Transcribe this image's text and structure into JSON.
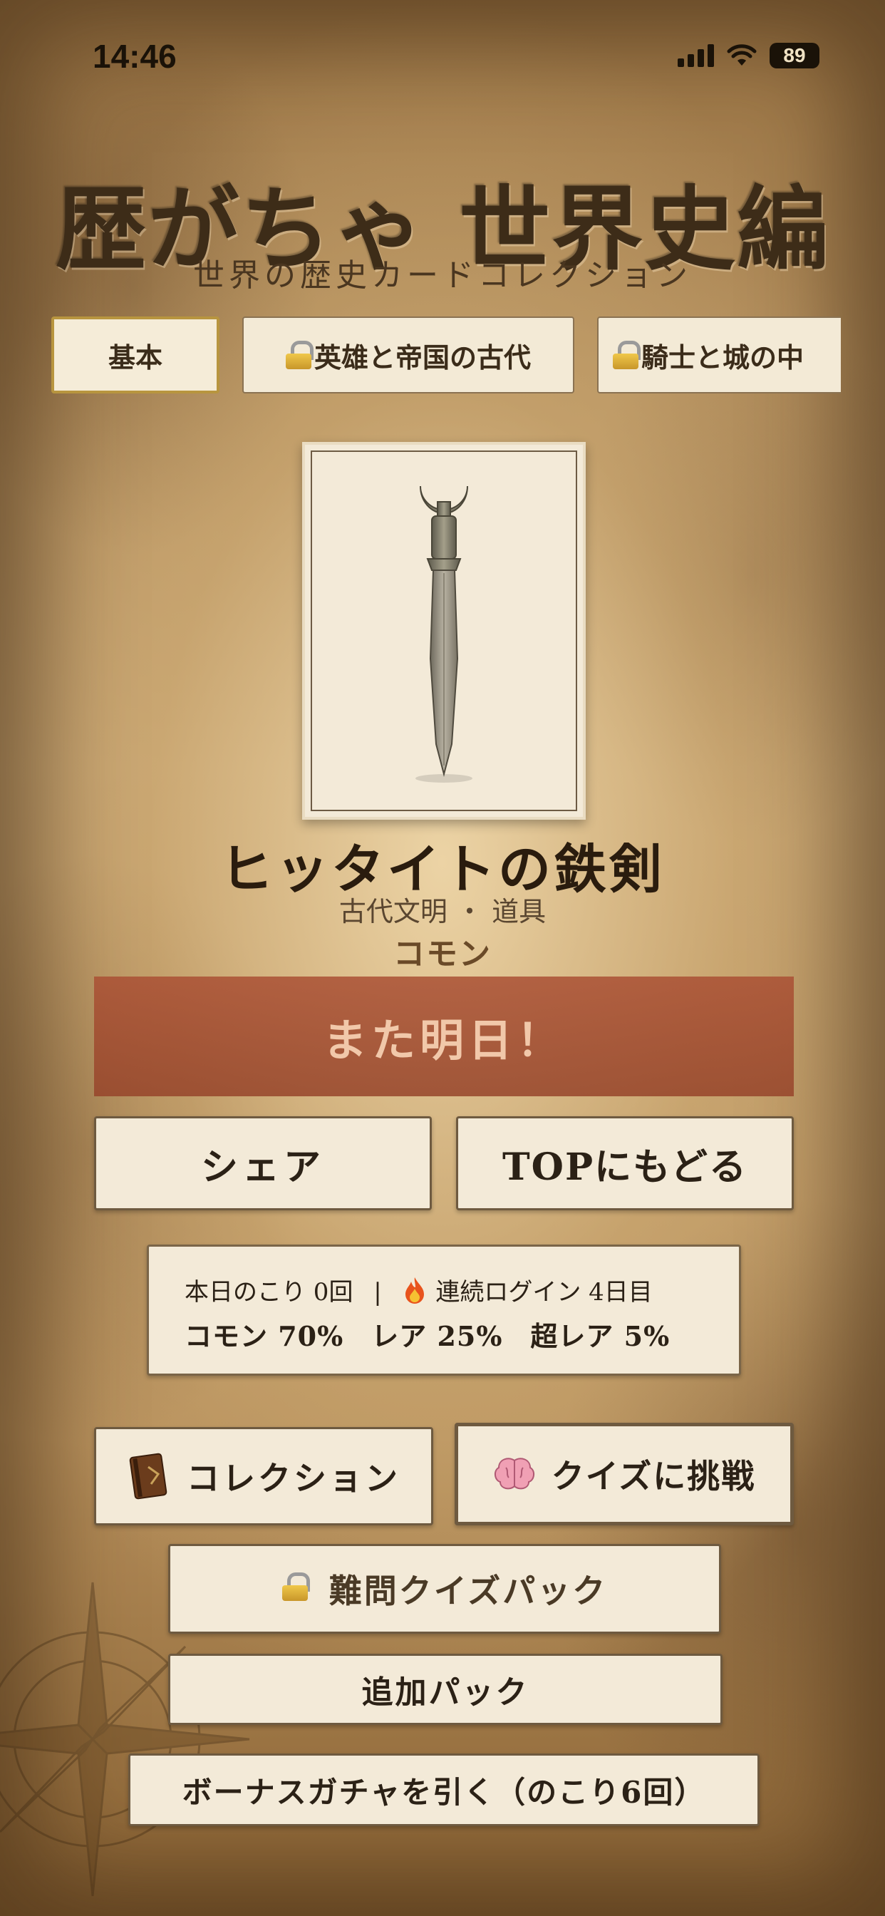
{
  "status_bar": {
    "time": "14:46",
    "battery": "89"
  },
  "header": {
    "title": "歴がちゃ 世界史編",
    "subtitle": "世界の歴史カードコレクション"
  },
  "tabs": [
    {
      "label": "基本",
      "locked": false,
      "active": true
    },
    {
      "label": "英雄と帝国の古代",
      "locked": true,
      "active": false
    },
    {
      "label": "騎士と城の中",
      "locked": true,
      "active": false
    }
  ],
  "card": {
    "name": "ヒッタイトの鉄剣",
    "meta": "古代文明 ・ 道具",
    "rarity": "コモン",
    "image_icon": "iron-sword-illustration"
  },
  "banner": {
    "text": "また明日！",
    "color": "#a8543a"
  },
  "actions": {
    "share_label": "シェア",
    "top_label": "TOPにもどる"
  },
  "info": {
    "remaining": "本日のこり 0回",
    "separator": "|",
    "streak": "連続ログイン 4日目",
    "streak_icon": "fire-icon",
    "rates": "コモン 70%　レア 25%　超レア 5%"
  },
  "menu": {
    "collection_label": "コレクション",
    "collection_icon": "book-icon",
    "quiz_label": "クイズに挑戦",
    "quiz_icon": "brain-icon",
    "hard_quiz_label": "難問クイズパック",
    "hard_quiz_icon": "lock-icon",
    "extra_pack_label": "追加パック",
    "bonus_label": "ボーナスガチャを引く（のこり6回）"
  },
  "colors": {
    "parchment": "#c7a472",
    "button_bg": "#f3ead8",
    "accent_gold": "#b8953f"
  }
}
